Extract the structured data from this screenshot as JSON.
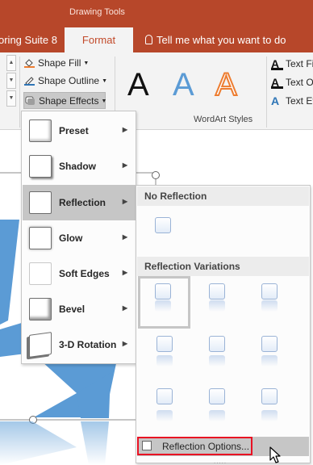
{
  "ribbon_tabs": {
    "context_label": "Drawing Tools",
    "suite_tab": "oring Suite 8",
    "format_tab": "Format",
    "tell_me": "Tell me what you want to do"
  },
  "shape_styles": {
    "fill": "Shape Fill",
    "outline": "Shape Outline",
    "effects": "Shape Effects"
  },
  "wordart": {
    "letters": [
      "A",
      "A",
      "A"
    ],
    "group_label": "WordArt Styles"
  },
  "text_group": {
    "fill": "Text Fi",
    "outline": "Text O",
    "effects": "Text Eff",
    "icon_letter": "A"
  },
  "effects_menu": {
    "items": [
      {
        "label": "Preset"
      },
      {
        "label": "Shadow"
      },
      {
        "label": "Reflection"
      },
      {
        "label": "Glow"
      },
      {
        "label": "Soft Edges"
      },
      {
        "label": "Bevel"
      },
      {
        "label": "3-D Rotation"
      }
    ],
    "active_index": 2
  },
  "reflection_gallery": {
    "no_reflection_header": "No Reflection",
    "variations_header": "Reflection Variations",
    "options_label": "Reflection Options...",
    "grip": "....."
  },
  "colors": {
    "tab_accent": "#b7472a",
    "shape_blue": "#5b9bd5",
    "highlight_outline": "#e81123"
  }
}
